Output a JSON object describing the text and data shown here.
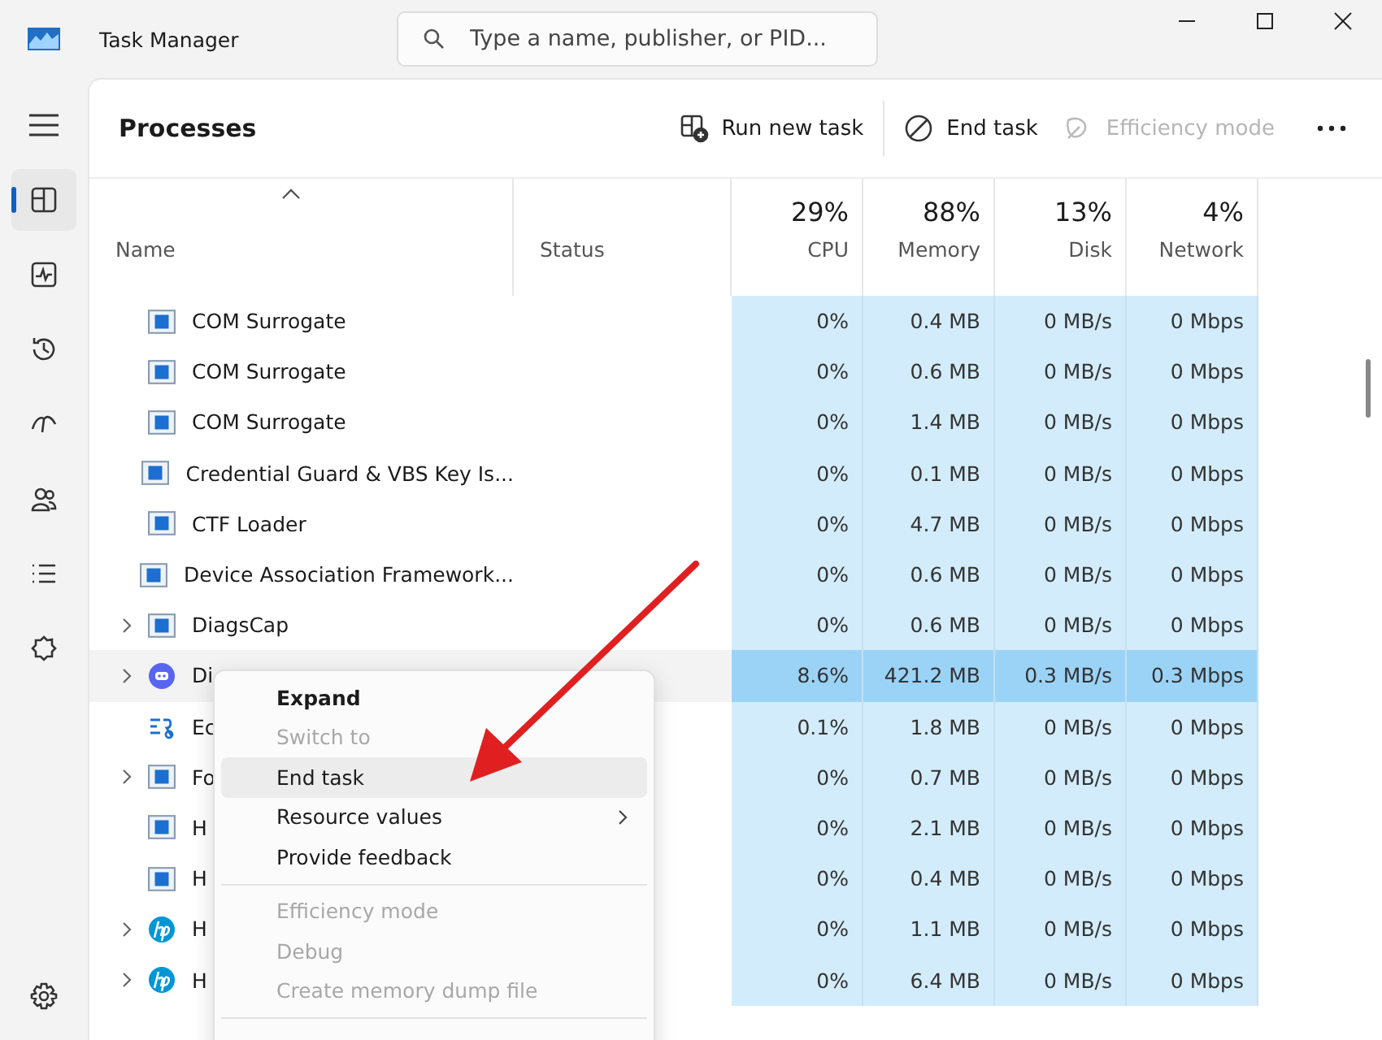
{
  "window": {
    "title": "Task Manager"
  },
  "search": {
    "placeholder": "Type a name, publisher, or PID..."
  },
  "sidebar": {
    "items": [
      {
        "selected": true
      },
      {
        "selected": false
      },
      {
        "selected": false
      },
      {
        "selected": false
      },
      {
        "selected": false
      },
      {
        "selected": false
      },
      {
        "selected": false
      }
    ]
  },
  "page_title": "Processes",
  "toolbar": [
    {
      "label": "Run new task",
      "disabled": false
    },
    {
      "label": "End task",
      "disabled": false
    },
    {
      "label": "Efficiency mode",
      "disabled": true
    }
  ],
  "table": {
    "columns": [
      {
        "label": "Name"
      },
      {
        "label": "Status"
      },
      {
        "label": "CPU",
        "total": "29%"
      },
      {
        "label": "Memory",
        "total": "88%"
      },
      {
        "label": "Disk",
        "total": "13%"
      },
      {
        "label": "Network",
        "total": "4%"
      }
    ],
    "rows": [
      {
        "name": "COM Surrogate",
        "kind": "app",
        "expandable": false,
        "selected": false,
        "values": [
          "0%",
          "0.4 MB",
          "0 MB/s",
          "0 Mbps"
        ]
      },
      {
        "name": "COM Surrogate",
        "kind": "app",
        "expandable": false,
        "selected": false,
        "values": [
          "0%",
          "0.6 MB",
          "0 MB/s",
          "0 Mbps"
        ]
      },
      {
        "name": "COM Surrogate",
        "kind": "app",
        "expandable": false,
        "selected": false,
        "values": [
          "0%",
          "1.4 MB",
          "0 MB/s",
          "0 Mbps"
        ]
      },
      {
        "name": "Credential Guard & VBS Key Is...",
        "kind": "app",
        "expandable": false,
        "selected": false,
        "values": [
          "0%",
          "0.1 MB",
          "0 MB/s",
          "0 Mbps"
        ]
      },
      {
        "name": "CTF Loader",
        "kind": "app",
        "expandable": false,
        "selected": false,
        "values": [
          "0%",
          "4.7 MB",
          "0 MB/s",
          "0 Mbps"
        ]
      },
      {
        "name": "Device Association Framework...",
        "kind": "app",
        "expandable": false,
        "selected": false,
        "values": [
          "0%",
          "0.6 MB",
          "0 MB/s",
          "0 Mbps"
        ]
      },
      {
        "name": "DiagsCap",
        "kind": "app",
        "expandable": true,
        "selected": false,
        "values": [
          "0%",
          "0.6 MB",
          "0 MB/s",
          "0 Mbps"
        ]
      },
      {
        "name": "Di",
        "kind": "chat",
        "expandable": true,
        "selected": true,
        "values": [
          "8.6%",
          "421.2 MB",
          "0.3 MB/s",
          "0.3 Mbps"
        ]
      },
      {
        "name": "Ec",
        "kind": "lines",
        "expandable": false,
        "selected": false,
        "values": [
          "0.1%",
          "1.8 MB",
          "0 MB/s",
          "0 Mbps"
        ]
      },
      {
        "name": "Fo",
        "kind": "app",
        "expandable": true,
        "selected": false,
        "values": [
          "0%",
          "0.7 MB",
          "0 MB/s",
          "0 Mbps"
        ]
      },
      {
        "name": "H",
        "kind": "app",
        "expandable": false,
        "selected": false,
        "values": [
          "0%",
          "2.1 MB",
          "0 MB/s",
          "0 Mbps"
        ]
      },
      {
        "name": "H",
        "kind": "app",
        "expandable": false,
        "selected": false,
        "values": [
          "0%",
          "0.4 MB",
          "0 MB/s",
          "0 Mbps"
        ]
      },
      {
        "name": "H",
        "kind": "brand",
        "expandable": true,
        "selected": false,
        "values": [
          "0%",
          "1.1 MB",
          "0 MB/s",
          "0 Mbps"
        ]
      },
      {
        "name": "H",
        "kind": "brand",
        "expandable": true,
        "selected": false,
        "values": [
          "0%",
          "6.4 MB",
          "0 MB/s",
          "0 Mbps"
        ]
      }
    ]
  },
  "context_menu": [
    {
      "kind": "item",
      "label": "Expand",
      "default": true,
      "disabled": false,
      "selected": false,
      "submenu": false
    },
    {
      "kind": "item",
      "label": "Switch to",
      "default": false,
      "disabled": true,
      "selected": false,
      "submenu": false
    },
    {
      "kind": "item",
      "label": "End task",
      "default": false,
      "disabled": false,
      "selected": true,
      "submenu": false
    },
    {
      "kind": "item",
      "label": "Resource values",
      "default": false,
      "disabled": false,
      "selected": false,
      "submenu": true
    },
    {
      "kind": "item",
      "label": "Provide feedback",
      "default": false,
      "disabled": false,
      "selected": false,
      "submenu": false
    },
    {
      "kind": "separator"
    },
    {
      "kind": "item",
      "label": "Efficiency mode",
      "default": false,
      "disabled": true,
      "selected": false,
      "submenu": false
    },
    {
      "kind": "item",
      "label": "Debug",
      "default": false,
      "disabled": true,
      "selected": false,
      "submenu": false
    },
    {
      "kind": "item",
      "label": "Create memory dump file",
      "default": false,
      "disabled": true,
      "selected": false,
      "submenu": false
    },
    {
      "kind": "separator"
    }
  ]
}
